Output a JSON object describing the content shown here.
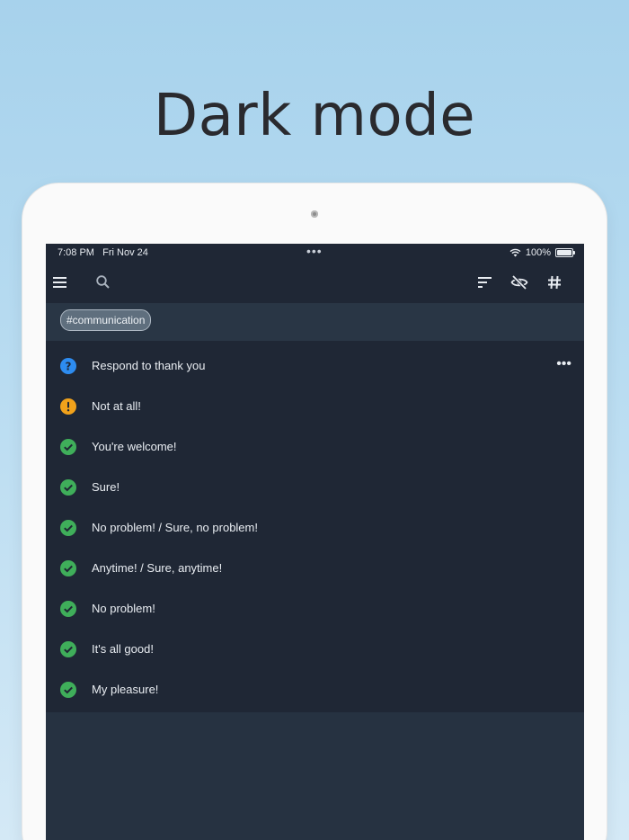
{
  "headline": "Dark mode",
  "status": {
    "time": "7:08 PM",
    "date": "Fri Nov 24",
    "dots": "•••",
    "battery": "100%"
  },
  "tag_filter": "#communication",
  "items": [
    {
      "label": "Respond to thank you",
      "status": "question"
    },
    {
      "label": "Not at all!",
      "status": "warning"
    },
    {
      "label": "You're welcome!",
      "status": "done"
    },
    {
      "label": "Sure!",
      "status": "done"
    },
    {
      "label": "No problem! / Sure, no problem!",
      "status": "done"
    },
    {
      "label": "Anytime! / Sure, anytime!",
      "status": "done"
    },
    {
      "label": "No problem!",
      "status": "done"
    },
    {
      "label": "It's all good!",
      "status": "done"
    },
    {
      "label": "My pleasure!",
      "status": "done"
    }
  ],
  "colors": {
    "question": "#2d8cf0",
    "warning": "#f1a21b",
    "done": "#3fae5a"
  },
  "icons": [
    "menu-icon",
    "search-icon",
    "sort-icon",
    "eye-off-icon",
    "hashtag-icon",
    "more-icon"
  ]
}
